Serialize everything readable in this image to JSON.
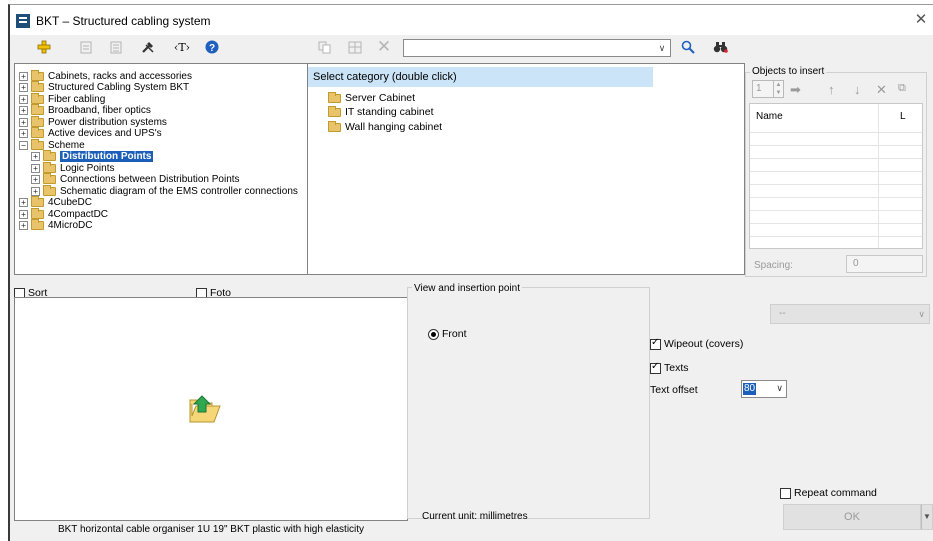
{
  "window": {
    "title": "BKT – Structured cabling system"
  },
  "toolbar": {
    "icons": [
      "add-icon",
      "disabled-doc-icon",
      "disabled-list-icon",
      "tools-icon",
      "text-tag-icon",
      "help-icon",
      "disabled-copy-icon",
      "disabled-grid-icon",
      "disabled-delete-icon",
      "search-icon",
      "binoculars-icon"
    ],
    "search_value": ""
  },
  "tree": {
    "items": [
      {
        "label": "Cabinets, racks and accessories",
        "expander": "+"
      },
      {
        "label": "Structured Cabling System BKT",
        "expander": "+"
      },
      {
        "label": "Fiber cabling",
        "expander": "+"
      },
      {
        "label": "Broadband, fiber optics",
        "expander": "+"
      },
      {
        "label": "Power distribution systems",
        "expander": "+"
      },
      {
        "label": "Active devices and UPS's",
        "expander": "+"
      },
      {
        "label": "Scheme",
        "expander": "−"
      },
      {
        "label": "Distribution Points",
        "expander": "+"
      },
      {
        "label": "Logic Points",
        "expander": "+"
      },
      {
        "label": "Connections between Distribution Points",
        "expander": "+"
      },
      {
        "label": "Schematic diagram of the EMS controller connections",
        "expander": "+"
      },
      {
        "label": "4CubeDC",
        "expander": "+"
      },
      {
        "label": "4CompactDC",
        "expander": "+"
      },
      {
        "label": "4MicroDC",
        "expander": "+"
      }
    ],
    "selected": "Distribution Points"
  },
  "category": {
    "header": "Select category (double click)",
    "items": [
      "Server Cabinet",
      "IT standing cabinet",
      "Wall hanging cabinet"
    ]
  },
  "objects": {
    "group_label": "Objects to insert",
    "count": "1",
    "col_name": "Name",
    "col_l": "L",
    "spacing_label": "Spacing:",
    "spacing_value": "0"
  },
  "options": {
    "sort_label": "Sort",
    "sort_checked": false,
    "foto_label": "Foto",
    "foto_checked": false,
    "view_group_label": "View and insertion point",
    "front_label": "Front",
    "front_selected": true,
    "disabled_select_value": "--",
    "wipeout_label": "Wipeout (covers)",
    "wipeout_checked": true,
    "texts_label": "Texts",
    "texts_checked": true,
    "text_offset_label": "Text offset",
    "text_offset_value": "80",
    "repeat_label": "Repeat command",
    "repeat_checked": false
  },
  "preview": {
    "caption": "BKT horizontal cable organiser 1U 19\" BKT plastic with high elasticity"
  },
  "footer": {
    "unit_label": "Current unit: millimetres",
    "ok_label": "OK"
  }
}
